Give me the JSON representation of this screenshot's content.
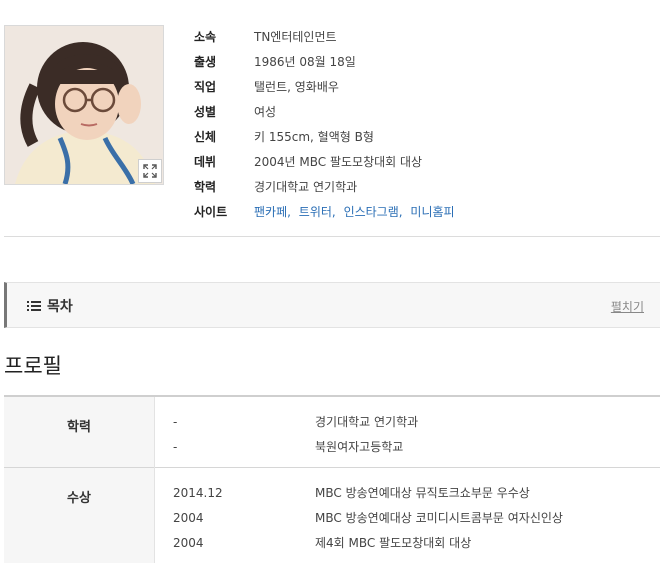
{
  "profile": {
    "photo_alt": "profile photo",
    "rows": [
      {
        "key": "소속",
        "value": "TN엔터테인먼트"
      },
      {
        "key": "출생",
        "value": "1986년 08월 18일"
      },
      {
        "key": "직업",
        "value": "탤런트, 영화배우"
      },
      {
        "key": "성별",
        "value": "여성"
      },
      {
        "key": "신체",
        "value": "키 155cm, 혈액형 B형"
      },
      {
        "key": "데뷔",
        "value": "2004년 MBC 팔도모창대회 대상"
      },
      {
        "key": "학력",
        "value": "경기대학교 연기학과"
      }
    ],
    "site": {
      "key": "사이트",
      "links": [
        "팬카페",
        "트위터",
        "인스타그램",
        "미니홈피"
      ],
      "separator": ","
    }
  },
  "toc": {
    "title": "목차",
    "expand_label": "펼치기"
  },
  "section": {
    "title": "프로필"
  },
  "table": {
    "education": {
      "label": "학력",
      "entries": [
        {
          "date": "-",
          "text": "경기대학교 연기학과"
        },
        {
          "date": "-",
          "text": "북원여자고등학교"
        }
      ]
    },
    "awards": {
      "label": "수상",
      "entries": [
        {
          "date": "2014.12",
          "text": "MBC 방송연예대상 뮤직토크쇼부문 우수상"
        },
        {
          "date": "2004",
          "text": "MBC 방송연예대상 코미디시트콤부문 여자신인상"
        },
        {
          "date": "2004",
          "text": "제4회 MBC 팔도모창대회 대상"
        }
      ]
    }
  }
}
